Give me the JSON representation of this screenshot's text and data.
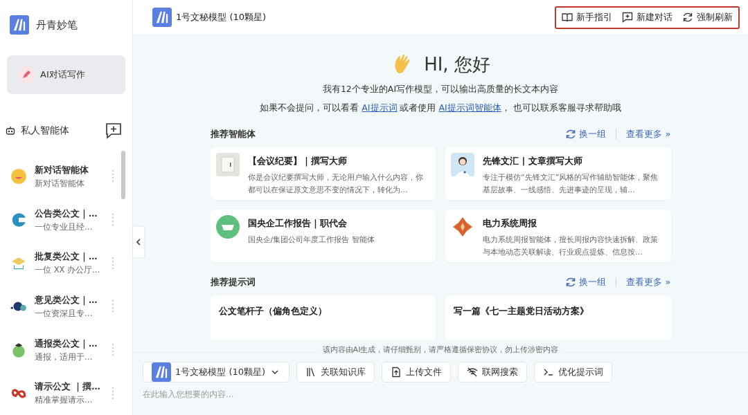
{
  "sidebar": {
    "app_name": "丹青妙笔",
    "primary_item": {
      "label": "AI对话写作",
      "selected": true
    },
    "section_title": "私人智能体",
    "agents": [
      {
        "title": "新对话智能体",
        "subtitle": "新对话智能体"
      },
      {
        "title": "公告类公文｜…",
        "subtitle": "一位专业且经…"
      },
      {
        "title": "批复类公文｜…",
        "subtitle": "一位 XX 办公厅…"
      },
      {
        "title": "意见类公文｜…",
        "subtitle": "一位资深且专…"
      },
      {
        "title": "通报类公文｜…",
        "subtitle": "通报，适用于…"
      },
      {
        "title": "请示公文 ｜撰…",
        "subtitle": "精准掌握请示…"
      }
    ]
  },
  "topbar": {
    "model": "1号文秘模型 (10颗星)",
    "actions": [
      "新手指引",
      "新建对话",
      "强制刷新"
    ]
  },
  "welcome": {
    "greeting": "HI, 您好",
    "line1": "我有12个专业的AI写作模型，可以输出高质量的长文本内容",
    "line2": [
      {
        "kind": "text",
        "text": "如果不会提问，可以看看 "
      },
      {
        "kind": "link",
        "text": "AI提示词"
      },
      {
        "kind": "text",
        "text": " 或者使用 "
      },
      {
        "kind": "link",
        "text": "AI提示词智能体"
      },
      {
        "kind": "text",
        "text": "， 也可以联系客服寻求帮助哦"
      }
    ]
  },
  "recommended_agents": {
    "title": "推荐智能体",
    "refresh": "换一组",
    "more": "查看更多 »",
    "cards": [
      {
        "title": "【会议纪要】｜撰写大师",
        "description": "你是会议纪要撰写大师，无论用户输入什么内容，你都可以在保证原文意思不变的情况下，转化为…"
      },
      {
        "title": "先锋文汇 | 文章撰写大师",
        "description": "专注于模仿“先锋文汇”风格的写作辅助智能体，聚焦基层故事、一线感悟、先进事迹的呈现，辅…"
      },
      {
        "title": "国央企工作报告｜职代会",
        "description": "国央企/集团公司年度工作报告 智能体"
      },
      {
        "title": "电力系统周报",
        "description": "电力系统周报智能体，擅长周报内容快速拆解、政策与本地动态关联解读、行业观点提炼、信息按…"
      }
    ]
  },
  "recommended_prompts": {
    "title": "推荐提示词",
    "refresh": "换一组",
    "more": "查看更多 »",
    "cards": [
      {
        "title": "公文笔杆子（偏角色定义）"
      },
      {
        "title": "写一篇《七一主题党日活动方案》"
      }
    ]
  },
  "composer": {
    "disclaimer": "该内容由AI生成，请仔细甄别，请严格遵循保密协议，勿上传涉密内容",
    "model": "1号文秘模型 (10颗星)",
    "tools": [
      "关联知识库",
      "上传文件",
      "联网搜索",
      "优化提示词"
    ],
    "placeholder": "在此输入您想要的内容..."
  }
}
